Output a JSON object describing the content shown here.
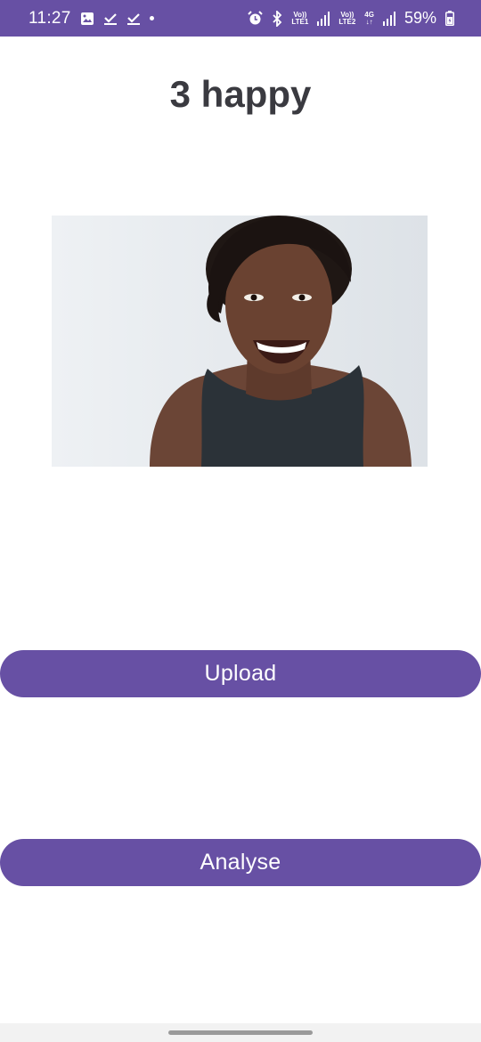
{
  "status_bar": {
    "time": "11:27",
    "battery": "59%",
    "lte1": "LTE1",
    "lte2": "LTE2",
    "net": "4G",
    "volte1": "Vo))",
    "volte2": "Vo))",
    "left_icons": [
      "gallery-icon",
      "check-icon",
      "check-icon",
      "dot-icon"
    ],
    "right_icons": [
      "alarm-icon",
      "bluetooth-icon",
      "signal-icon",
      "signal-icon",
      "battery-icon"
    ],
    "color": "#6750a4"
  },
  "main": {
    "title": "3 happy",
    "upload_label": "Upload",
    "analyse_label": "Analyse"
  },
  "colors": {
    "accent": "#6750a4",
    "title_text": "#3a3a40",
    "button_text": "#ffffff"
  }
}
